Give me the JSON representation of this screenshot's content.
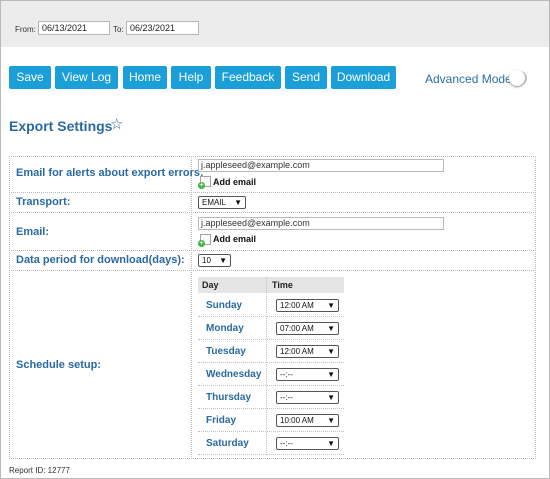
{
  "filters": {
    "from_label": "From:",
    "from_value": "06/13/2021",
    "to_label": "To:",
    "to_value": "06/23/2021"
  },
  "toolbar": {
    "buttons": [
      "Save",
      "View Log",
      "Home",
      "Help",
      "Feedback",
      "Send",
      "Download"
    ],
    "advanced_mode_label": "Advanced Mode",
    "advanced_mode_on": false,
    "button_color": "#1a9fd9"
  },
  "section": {
    "title": "Export Settings",
    "star_icon": "star-outline-icon"
  },
  "settings": {
    "alerts_email": {
      "label": "Email for alerts about export errors:",
      "value": "j.appleseed@example.com",
      "add_label": "Add email"
    },
    "transport": {
      "label": "Transport:",
      "value": "EMAIL"
    },
    "email": {
      "label": "Email:",
      "value": "j.appleseed@example.com",
      "add_label": "Add email"
    },
    "data_period": {
      "label": "Data period for download(days):",
      "value": "10"
    },
    "schedule": {
      "label": "Schedule setup:",
      "day_header": "Day",
      "time_header": "Time",
      "rows": [
        {
          "day": "Sunday",
          "time": "12:00 AM"
        },
        {
          "day": "Monday",
          "time": "07:00 AM"
        },
        {
          "day": "Tuesday",
          "time": "12:00 AM"
        },
        {
          "day": "Wednesday",
          "time": "--:--"
        },
        {
          "day": "Thursday",
          "time": "--:--"
        },
        {
          "day": "Friday",
          "time": "10:00 AM"
        },
        {
          "day": "Saturday",
          "time": "--:--"
        }
      ]
    }
  },
  "footer": {
    "report_id": "Report ID: 12777"
  },
  "colors": {
    "label_blue": "#2a6aa2",
    "toolbar_background": "#ececec"
  }
}
